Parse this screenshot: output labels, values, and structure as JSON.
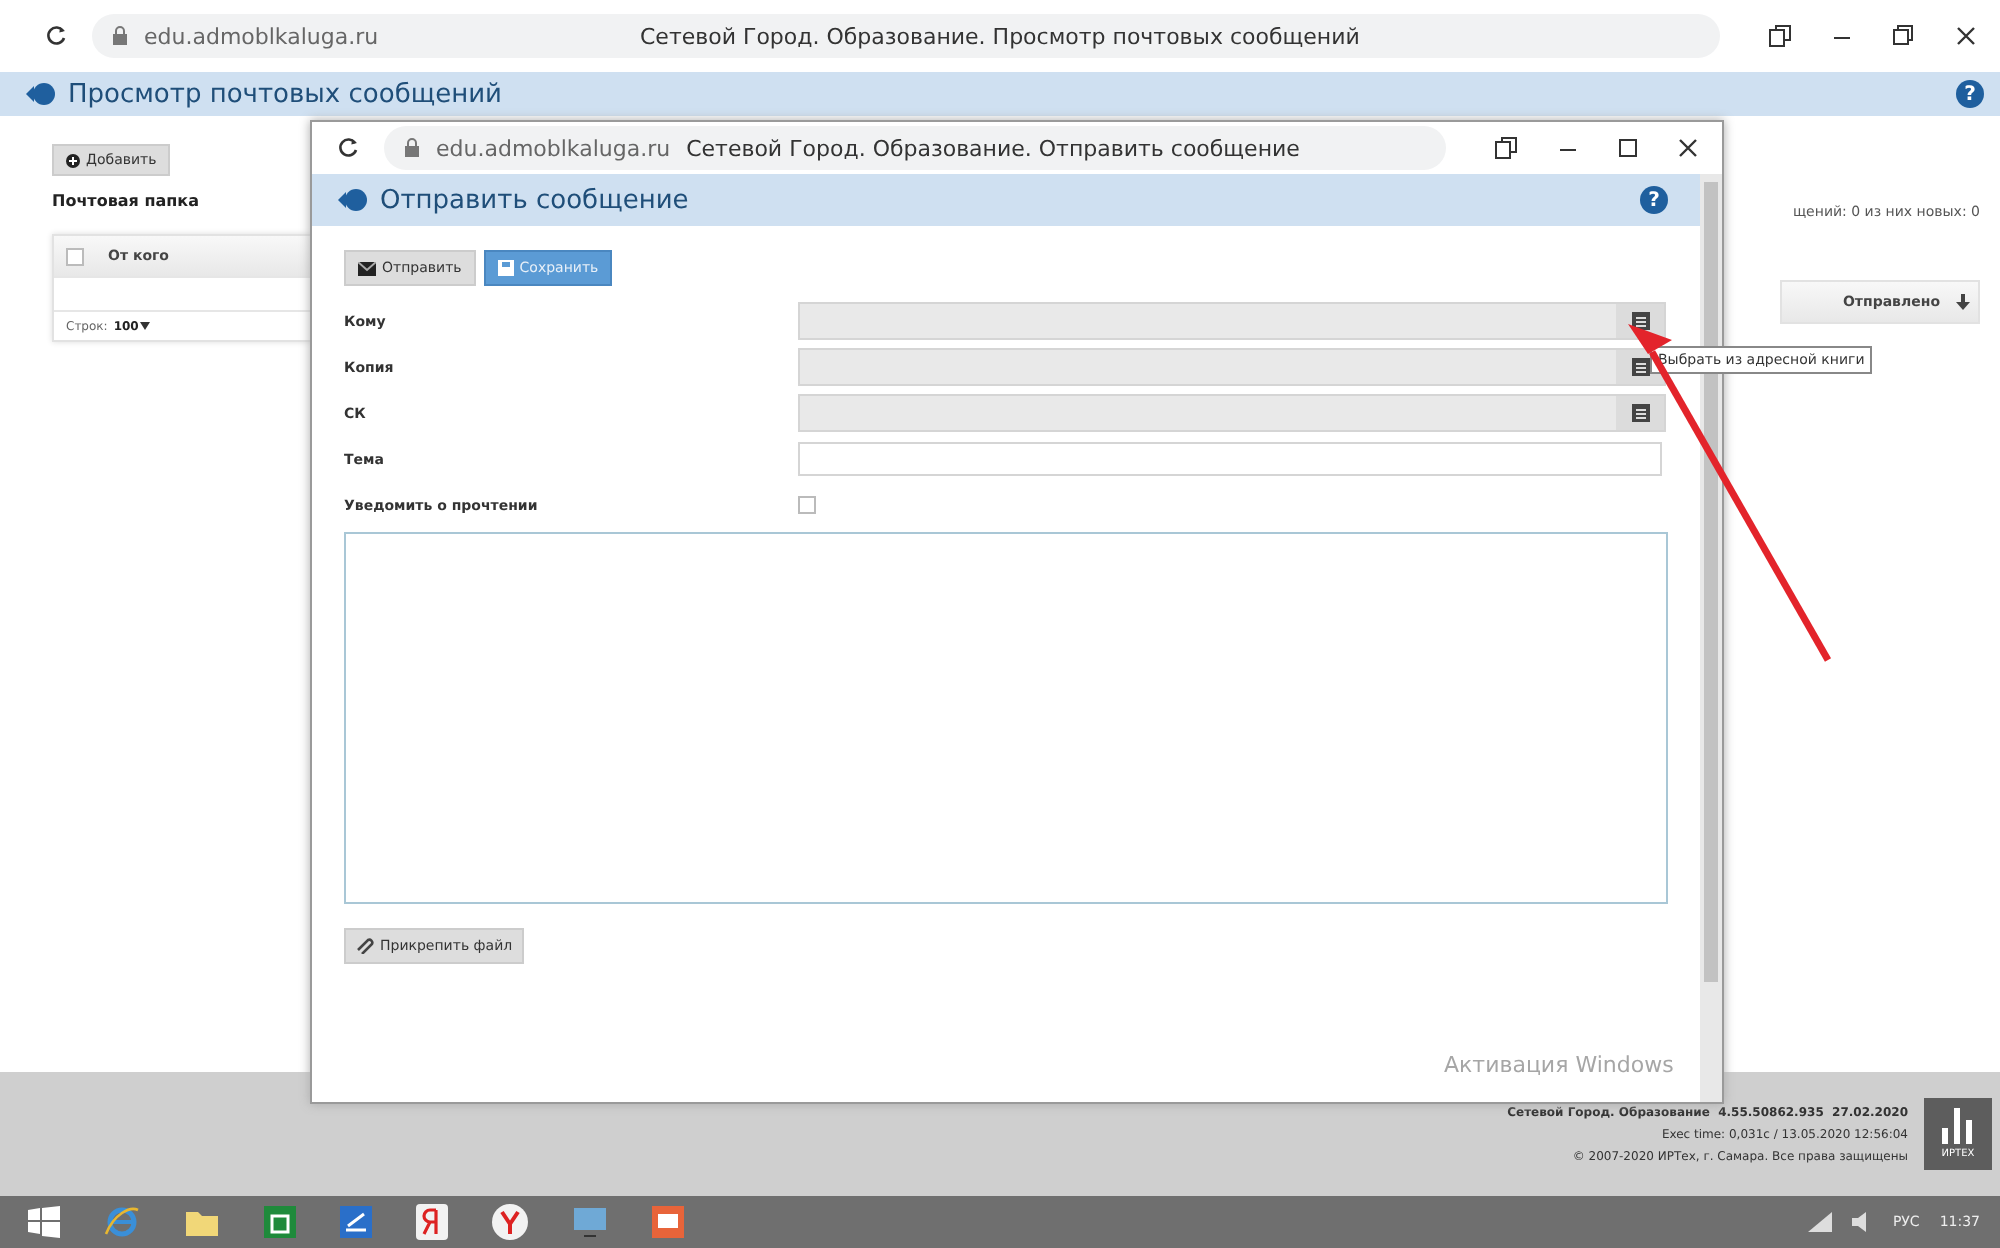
{
  "browser": {
    "url": "edu.admoblkaluga.ru",
    "title": "Сетевой Город. Образование. Просмотр почтовых сообщений"
  },
  "page": {
    "title": "Просмотр почтовых сообщений",
    "help": "?",
    "add_button": "Добавить",
    "folder_label": "Почтовая папка",
    "select_all_checked": false,
    "counter": "щений: 0 из них новых: 0",
    "columns": [
      {
        "label": "От кого"
      },
      {
        "label": "Отправлено"
      }
    ],
    "rows_label": "Строк:",
    "rows_value": "100"
  },
  "popup": {
    "url": "edu.admoblkaluga.ru",
    "title": "Сетевой Город. Образование. Отправить сообщение",
    "header": "Отправить сообщение",
    "help": "?",
    "buttons": [
      {
        "label": "Отправить",
        "kind": "send"
      },
      {
        "label": "Сохранить",
        "kind": "save"
      }
    ],
    "fields": [
      {
        "label": "Кому",
        "kind": "address"
      },
      {
        "label": "Копия",
        "kind": "address"
      },
      {
        "label": "СК",
        "kind": "address"
      },
      {
        "label": "Тема",
        "kind": "text"
      },
      {
        "label": "Уведомить о прочтении",
        "kind": "checkbox",
        "checked": false
      }
    ],
    "attach_button": "Прикрепить файл",
    "tooltip": "Выбрать из адресной книги"
  },
  "footer": {
    "product": "Сетевой Город. Образование",
    "version": "4.55.50862.935",
    "date": "27.02.2020",
    "exec": "Exec time: 0,031c / 13.05.2020 12:56:04",
    "copyright": "© 2007-2020 ИРТех, г. Самара. Все права защищены",
    "logo": "ИРТЕХ"
  },
  "watermark": "Активация Windows",
  "taskbar": {
    "lang": "РУС",
    "time": "11:37"
  }
}
